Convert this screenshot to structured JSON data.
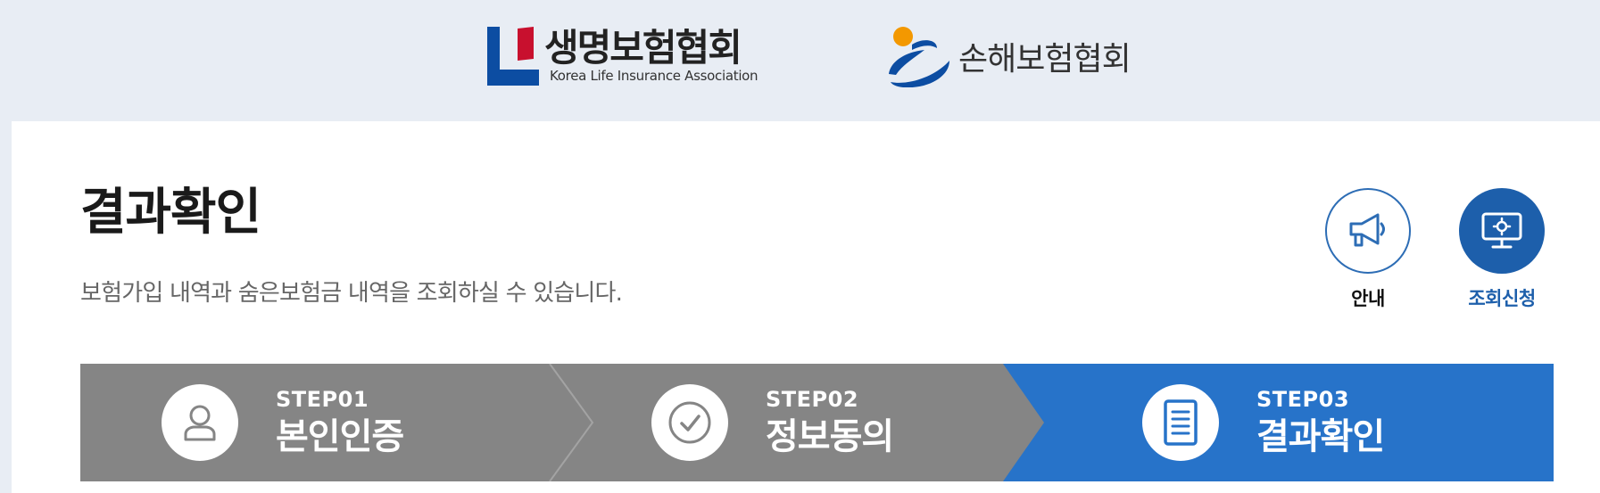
{
  "header": {
    "life_logo": {
      "korean": "생명보험협회",
      "english": "Korea Life Insurance Association",
      "colors": {
        "red": "#c8102e",
        "blue": "#0c4da2"
      }
    },
    "nonlife_logo": {
      "korean": "손해보험협회",
      "colors": {
        "orange": "#f39800",
        "blue": "#0c4da2"
      }
    }
  },
  "page": {
    "title": "결과확인",
    "subtitle": "보험가입 내역과 숨은보험금 내역을 조회하실 수 있습니다."
  },
  "actions": {
    "guide": {
      "label": "안내",
      "icon": "megaphone-icon"
    },
    "apply": {
      "label": "조회신청",
      "icon": "monitor-gear-icon"
    }
  },
  "steps": [
    {
      "number": "STEP01",
      "name": "본인인증",
      "icon": "user-icon",
      "active": false
    },
    {
      "number": "STEP02",
      "name": "정보동의",
      "icon": "check-circle-icon",
      "active": false
    },
    {
      "number": "STEP03",
      "name": "결과확인",
      "icon": "document-icon",
      "active": true
    }
  ],
  "colors": {
    "background": "#e8edf4",
    "step_inactive": "#858585",
    "step_active": "#2773c9",
    "accent": "#1d5fab"
  }
}
